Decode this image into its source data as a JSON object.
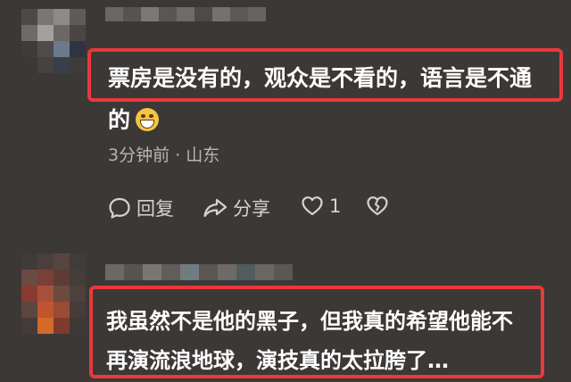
{
  "comments": [
    {
      "text_line1": "票房是没有的，观众是不看的，语言是不通",
      "text_line2": "的",
      "emoji": "grinning-face",
      "time": "3分钟前",
      "dot": "·",
      "location": "山东",
      "reply_label": "回复",
      "share_label": "分享",
      "like_count": "1"
    },
    {
      "text_line1": "我虽然不是他的黑子，但我真的希望他能不",
      "text_line2": "再演流浪地球，演技真的太拉胯了…"
    }
  ],
  "colors": {
    "background": "#3c3836",
    "highlight": "#e8393d",
    "text": "#ffffff",
    "meta": "#b9b4b0"
  }
}
